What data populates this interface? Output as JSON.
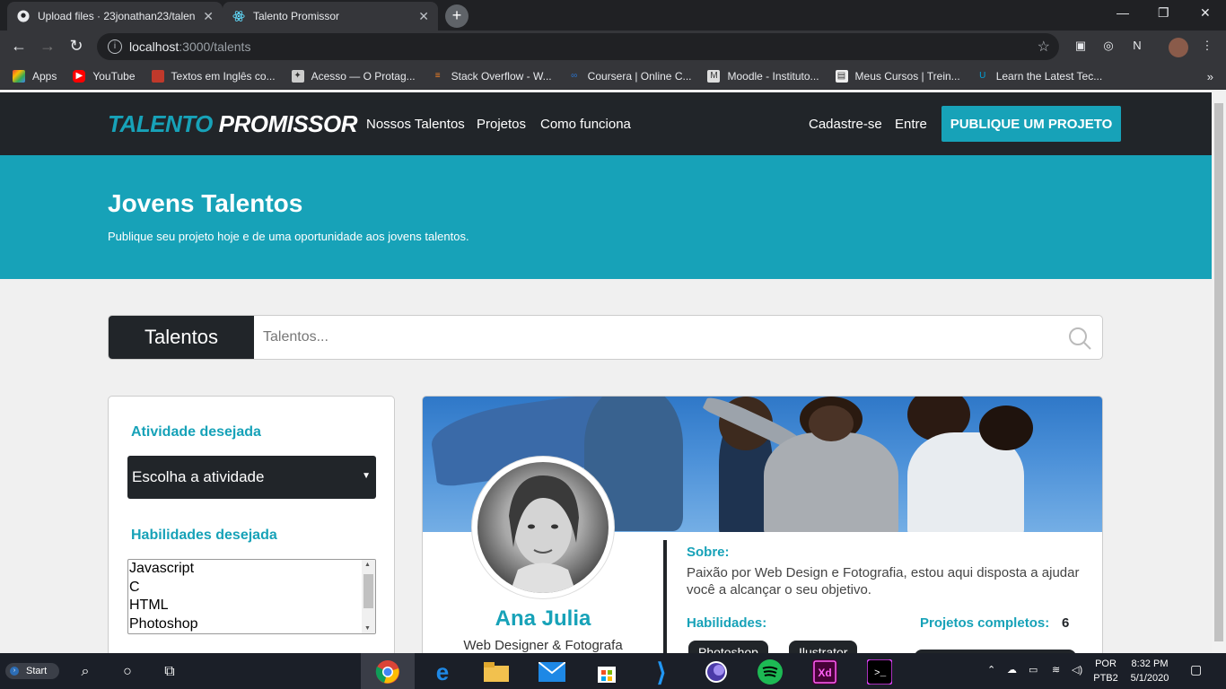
{
  "browser": {
    "tabs": [
      {
        "title": "Upload files · 23jonathan23/talen",
        "active": false
      },
      {
        "title": "Talento Promissor",
        "active": true
      }
    ],
    "url_host": "localhost",
    "url_path": ":3000/talents",
    "bookmarks": [
      {
        "label": "Apps",
        "icon": "apps-grid-icon",
        "color": "#e94235"
      },
      {
        "label": "YouTube",
        "icon": "youtube-icon",
        "color": "#ff0000"
      },
      {
        "label": "Textos em Inglês co...",
        "icon": "bookmark-icon",
        "color": "#c0392b"
      },
      {
        "label": "Acesso — O Protag...",
        "icon": "bookmark-icon",
        "color": "#cccccc"
      },
      {
        "label": "Stack Overflow - W...",
        "icon": "stackoverflow-icon",
        "color": "#f48024"
      },
      {
        "label": "Coursera | Online C...",
        "icon": "coursera-icon",
        "color": "#2a73cc"
      },
      {
        "label": "Moodle - Instituto...",
        "icon": "moodle-icon",
        "color": "#dddddd"
      },
      {
        "label": "Meus Cursos | Trein...",
        "icon": "bookmark-icon",
        "color": "#eeeeee"
      },
      {
        "label": "Learn the Latest Tec...",
        "icon": "udemy-icon",
        "color": "#00a2d8"
      }
    ]
  },
  "site": {
    "logo_part1": "TALENTO",
    "logo_part2": "PROMISSOR",
    "nav": [
      "Nossos Talentos",
      "Projetos",
      "Como funciona"
    ],
    "signup": "Cadastre-se",
    "login": "Entre",
    "cta": "PUBLIQUE UM PROJETO",
    "accent": "#17a2b8",
    "dark": "#212529"
  },
  "hero": {
    "title": "Jovens Talentos",
    "subtitle": "Publique seu projeto hoje e de uma oportunidade aos jovens talentos."
  },
  "search": {
    "label": "Talentos",
    "placeholder": "Talentos..."
  },
  "filters": {
    "activity_title": "Atividade desejada",
    "activity_selected": "Escolha a atividade",
    "skills_title": "Habilidades desejada",
    "skills_options": [
      "Javascript",
      "C",
      "HTML",
      "Photoshop"
    ]
  },
  "talent": {
    "name": "Ana Julia",
    "role": "Web Designer & Fotografa",
    "about_title": "Sobre:",
    "about": "Paixão por Web Design e Fotografia, estou aqui disposta a ajudar você a alcançar o seu objetivo.",
    "skills_title": "Habilidades:",
    "skills": [
      "Photoshop",
      "Ilustrator"
    ],
    "projects_title": "Projetos completos:",
    "projects_count": "6"
  },
  "taskbar": {
    "start": "Start",
    "lang": "POR",
    "layout": "PTB2",
    "time": "8:32 PM",
    "date": "5/1/2020"
  }
}
